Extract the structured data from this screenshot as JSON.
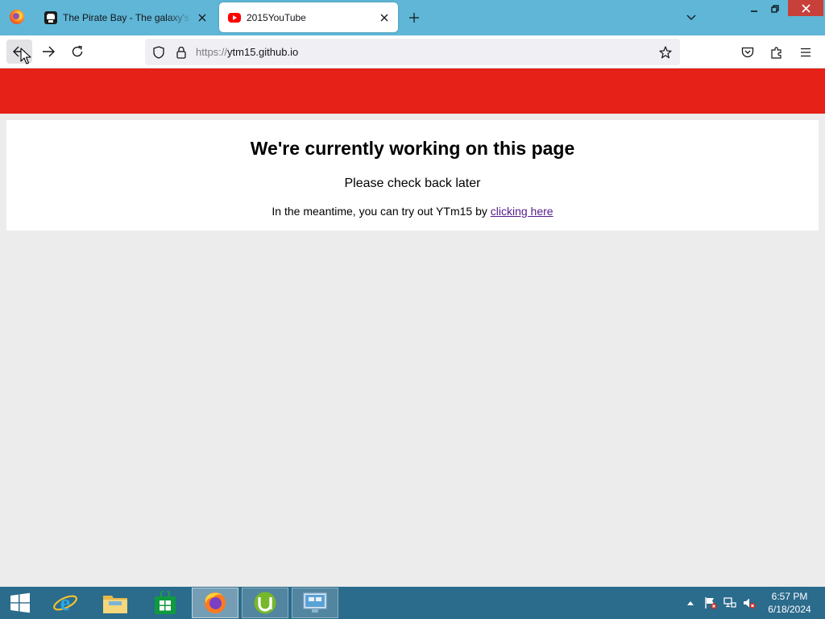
{
  "browser": {
    "tabs": [
      {
        "title": "The Pirate Bay - The galaxy's most resilient BitTorrent site",
        "favicon": "pirate-ship-icon",
        "active": false
      },
      {
        "title": "2015YouTube",
        "favicon": "youtube-icon",
        "active": true
      }
    ],
    "url": {
      "scheme": "https://",
      "host": "ytm15.github.io"
    }
  },
  "page": {
    "header_color": "#e62117",
    "heading": "We're currently working on this page",
    "subheading": "Please check back later",
    "meantime_text": "In the meantime, you can try out YTm15 by ",
    "meantime_link": "clicking here"
  },
  "taskbar": {
    "apps": [
      "internet-explorer-icon",
      "file-explorer-icon",
      "store-icon",
      "firefox-icon",
      "utorrent-icon",
      "remote-desktop-icon"
    ],
    "time": "6:57 PM",
    "date": "6/18/2024"
  },
  "colors": {
    "titlebar": "#5fb6d6",
    "taskbar": "#2b6b8c",
    "link_visited": "#551a8b"
  }
}
